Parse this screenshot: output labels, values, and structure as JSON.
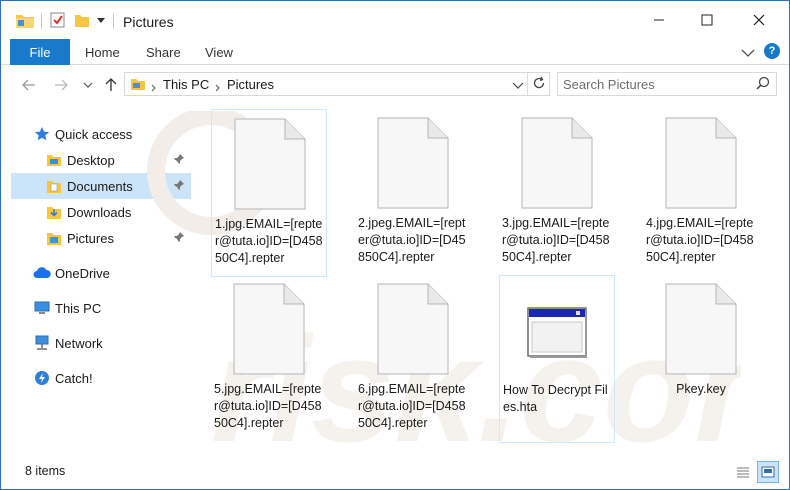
{
  "window": {
    "title": "Pictures"
  },
  "ribbon": {
    "file_label": "File",
    "tabs": [
      "Home",
      "Share",
      "View"
    ]
  },
  "address": {
    "crumbs": [
      "This PC",
      "Pictures"
    ],
    "search_placeholder": "Search Pictures"
  },
  "sidebar": {
    "quick_access": "Quick access",
    "items": [
      {
        "label": "Desktop",
        "icon": "desktop-folder-icon",
        "pinned": true
      },
      {
        "label": "Documents",
        "icon": "documents-folder-icon",
        "pinned": true,
        "selected": true
      },
      {
        "label": "Downloads",
        "icon": "downloads-folder-icon",
        "pinned": true
      },
      {
        "label": "Pictures",
        "icon": "pictures-folder-icon",
        "pinned": true
      }
    ],
    "onedrive": "OneDrive",
    "this_pc": "This PC",
    "network": "Network",
    "catch": "Catch!"
  },
  "files": [
    {
      "name": "1.jpg.EMAIL=[repter@tuta.io]ID=[D45850C4].repter",
      "icon": "blank-file-icon"
    },
    {
      "name": "2.jpeg.EMAIL=[repter@tuta.io]ID=[D45850C4].repter",
      "icon": "blank-file-icon"
    },
    {
      "name": "3.jpg.EMAIL=[repter@tuta.io]ID=[D45850C4].repter",
      "icon": "blank-file-icon"
    },
    {
      "name": "4.jpg.EMAIL=[repter@tuta.io]ID=[D45850C4].repter",
      "icon": "blank-file-icon"
    },
    {
      "name": "5.jpg.EMAIL=[repter@tuta.io]ID=[D45850C4].repter",
      "icon": "blank-file-icon"
    },
    {
      "name": "6.jpg.EMAIL=[repter@tuta.io]ID=[D45850C4].repter",
      "icon": "blank-file-icon"
    },
    {
      "name": "How To Decrypt Files.hta",
      "icon": "hta-application-icon"
    },
    {
      "name": "Pkey.key",
      "icon": "blank-file-icon"
    }
  ],
  "status": {
    "item_count": "8 items"
  },
  "colors": {
    "accent": "#1979ca",
    "selection": "#cce4f7",
    "window_border": "#2b6fb6"
  }
}
